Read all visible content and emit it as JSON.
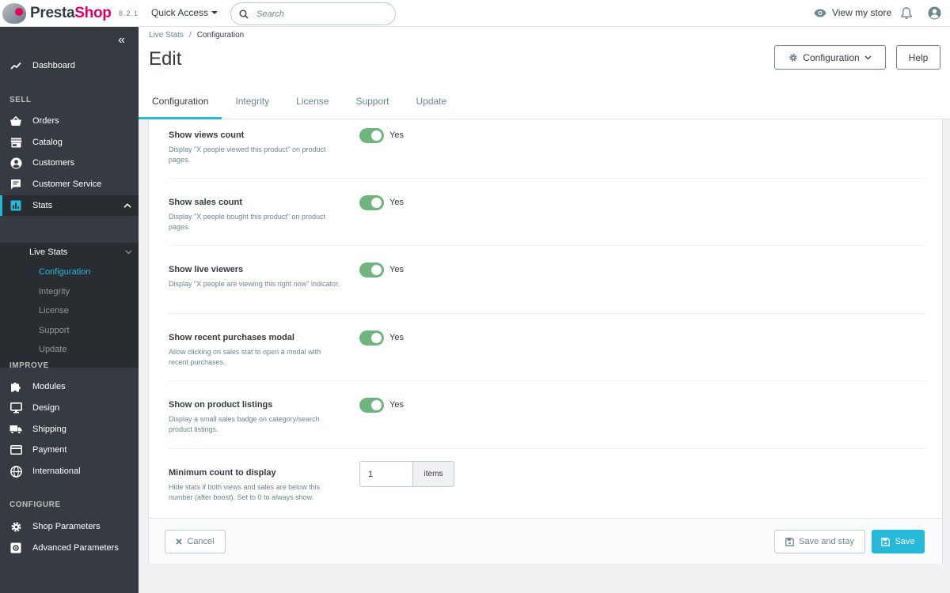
{
  "header": {
    "logo_part1": "Presta",
    "logo_part2": "Shop",
    "version": "8.2.1",
    "quick_access": "Quick Access",
    "search_placeholder": "Search",
    "view_store": "View my store"
  },
  "sidebar": {
    "dashboard": "Dashboard",
    "sections": {
      "sell": "SELL",
      "improve": "IMPROVE",
      "configure": "CONFIGURE"
    },
    "sell_items": [
      "Orders",
      "Catalog",
      "Customers",
      "Customer Service",
      "Stats"
    ],
    "submenu_head": "Live Stats",
    "submenu_items": [
      "Configuration",
      "Integrity",
      "License",
      "Support",
      "Update"
    ],
    "improve_items": [
      "Modules",
      "Design",
      "Shipping",
      "Payment",
      "International"
    ],
    "configure_items": [
      "Shop Parameters",
      "Advanced Parameters"
    ]
  },
  "page": {
    "breadcrumb": [
      "Live Stats",
      "Configuration"
    ],
    "title": "Edit",
    "config_button": "Configuration",
    "help_button": "Help",
    "tabs": [
      "Configuration",
      "Integrity",
      "License",
      "Support",
      "Update"
    ]
  },
  "form": {
    "rows": [
      {
        "label": "Show views count",
        "help": "Display \"X people viewed this product\" on product pages.",
        "value": "Yes"
      },
      {
        "label": "Show sales count",
        "help": "Display \"X people bought this product\" on product pages.",
        "value": "Yes"
      },
      {
        "label": "Show live viewers",
        "help": "Display \"X people are viewing this right now\" indicator.",
        "value": "Yes"
      },
      {
        "label": "Show recent purchases modal",
        "help": "Allow clicking on sales stat to open a modal with recent purchases.",
        "value": "Yes"
      },
      {
        "label": "Show on product listings",
        "help": "Display a small sales badge on category/search product listings.",
        "value": "Yes"
      }
    ],
    "min_count": {
      "label": "Minimum count to display",
      "help": "Hide stats if both views and sales are below this number (after boost). Set to 0 to always show.",
      "value": "1",
      "suffix": "items"
    },
    "cancel": "Cancel",
    "save_and_stay": "Save and stay",
    "save": "Save"
  },
  "colors": {
    "accent": "#25b9d7",
    "switch_on": "#70b580",
    "sidebar": "#363a41",
    "brand_pink": "#df0067"
  }
}
